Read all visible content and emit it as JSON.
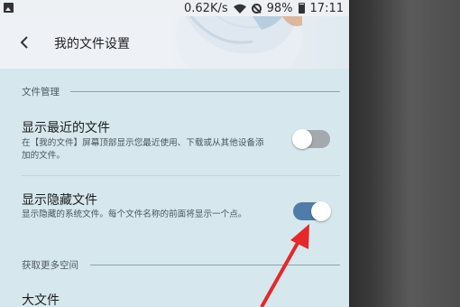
{
  "status_bar": {
    "speed": "0.62K/s",
    "battery": "98%",
    "time": "17:11"
  },
  "header": {
    "title": "我的文件设置"
  },
  "sections": [
    {
      "title": "文件管理",
      "items": [
        {
          "title": "显示最近的文件",
          "desc": "在【我的文件】屏幕顶部显示您最近使用、下载或从其他设备添加的文件。",
          "enabled": false
        },
        {
          "title": "显示隐藏文件",
          "desc": "显示隐藏的系统文件。每个文件名称的前面将显示一个点。",
          "enabled": true
        }
      ]
    },
    {
      "title": "获取更多空间",
      "items": [
        {
          "title": "大文件"
        }
      ]
    }
  ],
  "colors": {
    "toggle_on": "#4f7ca8",
    "toggle_off": "#a3a9ac",
    "annotation_arrow": "#e5282a",
    "content_bg": "#d6e8ee"
  }
}
